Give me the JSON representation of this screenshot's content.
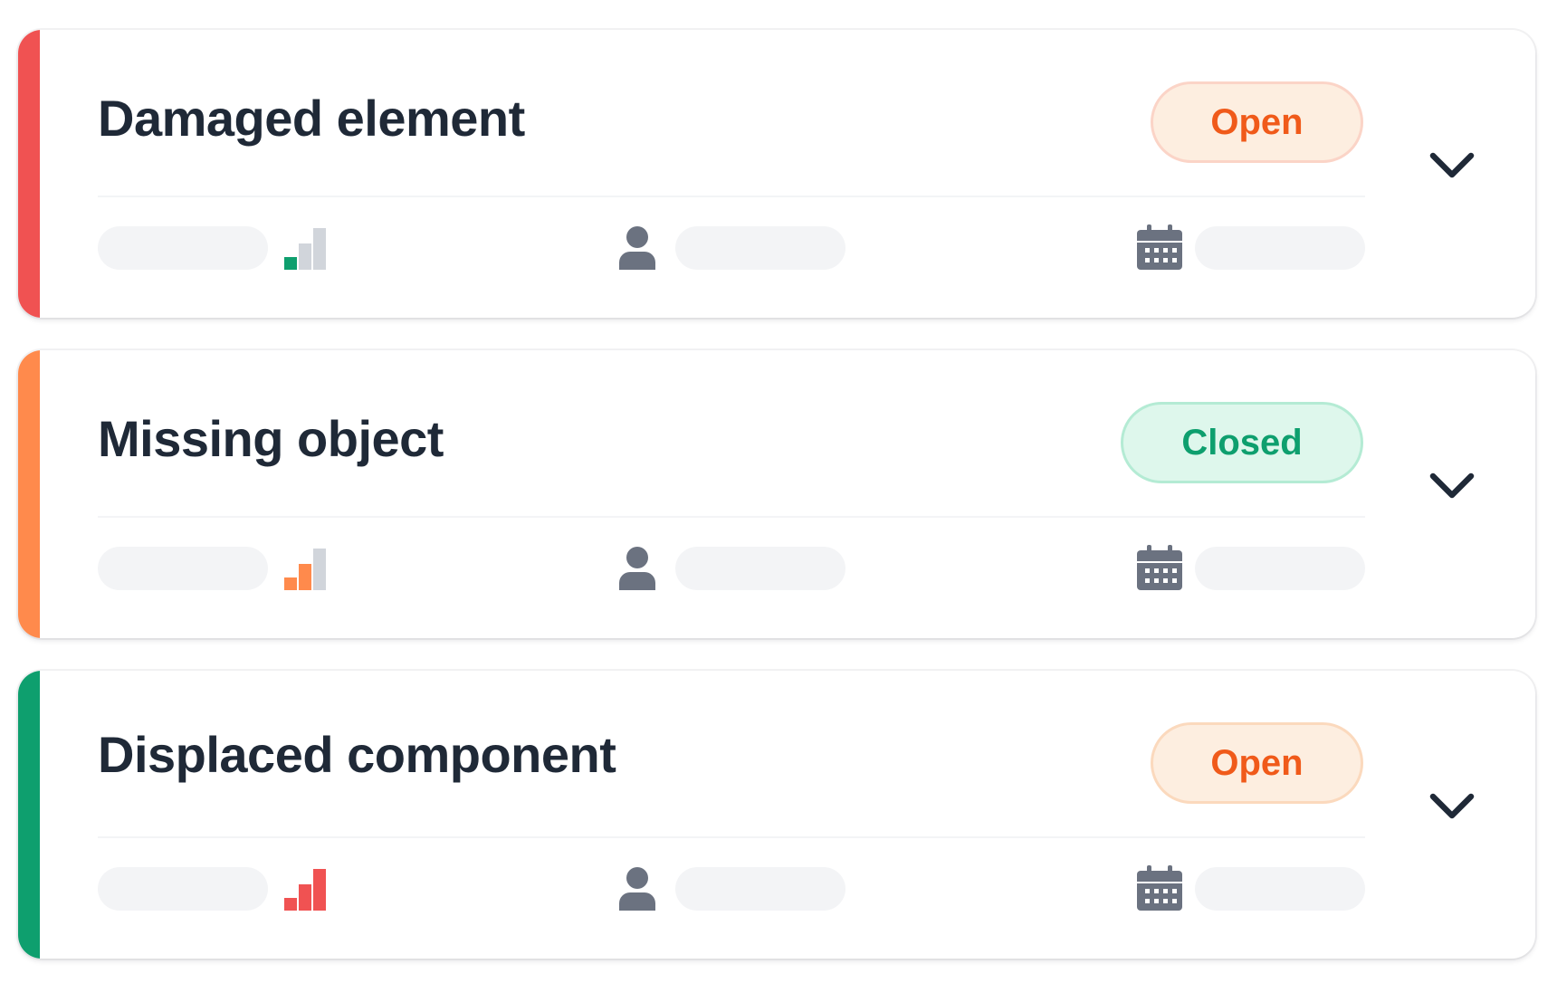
{
  "issues": [
    {
      "title": "Damaged element",
      "status": "Open",
      "status_type": "open",
      "accent_color": "#f05252",
      "priority_level": 1,
      "priority_color": "#0e9f6e",
      "icons": [
        "signal-bars-icon",
        "person-icon",
        "calendar-icon",
        "chevron-down-icon"
      ]
    },
    {
      "title": "Missing object",
      "status": "Closed",
      "status_type": "closed",
      "accent_color": "#ff8a4c",
      "priority_level": 2,
      "priority_color": "#ff8a4c",
      "icons": [
        "signal-bars-icon",
        "person-icon",
        "calendar-icon",
        "chevron-down-icon"
      ]
    },
    {
      "title": "Displaced component",
      "status": "Open",
      "status_type": "open",
      "accent_color": "#0e9f6e",
      "priority_level": 3,
      "priority_color": "#f05252",
      "icons": [
        "signal-bars-icon",
        "person-icon",
        "calendar-icon",
        "chevron-down-icon"
      ]
    }
  ],
  "colors": {
    "title_text": "#1f2937",
    "icon_gray": "#6b7280",
    "inactive_bar": "#d1d5db",
    "placeholder": "#f3f4f6"
  }
}
